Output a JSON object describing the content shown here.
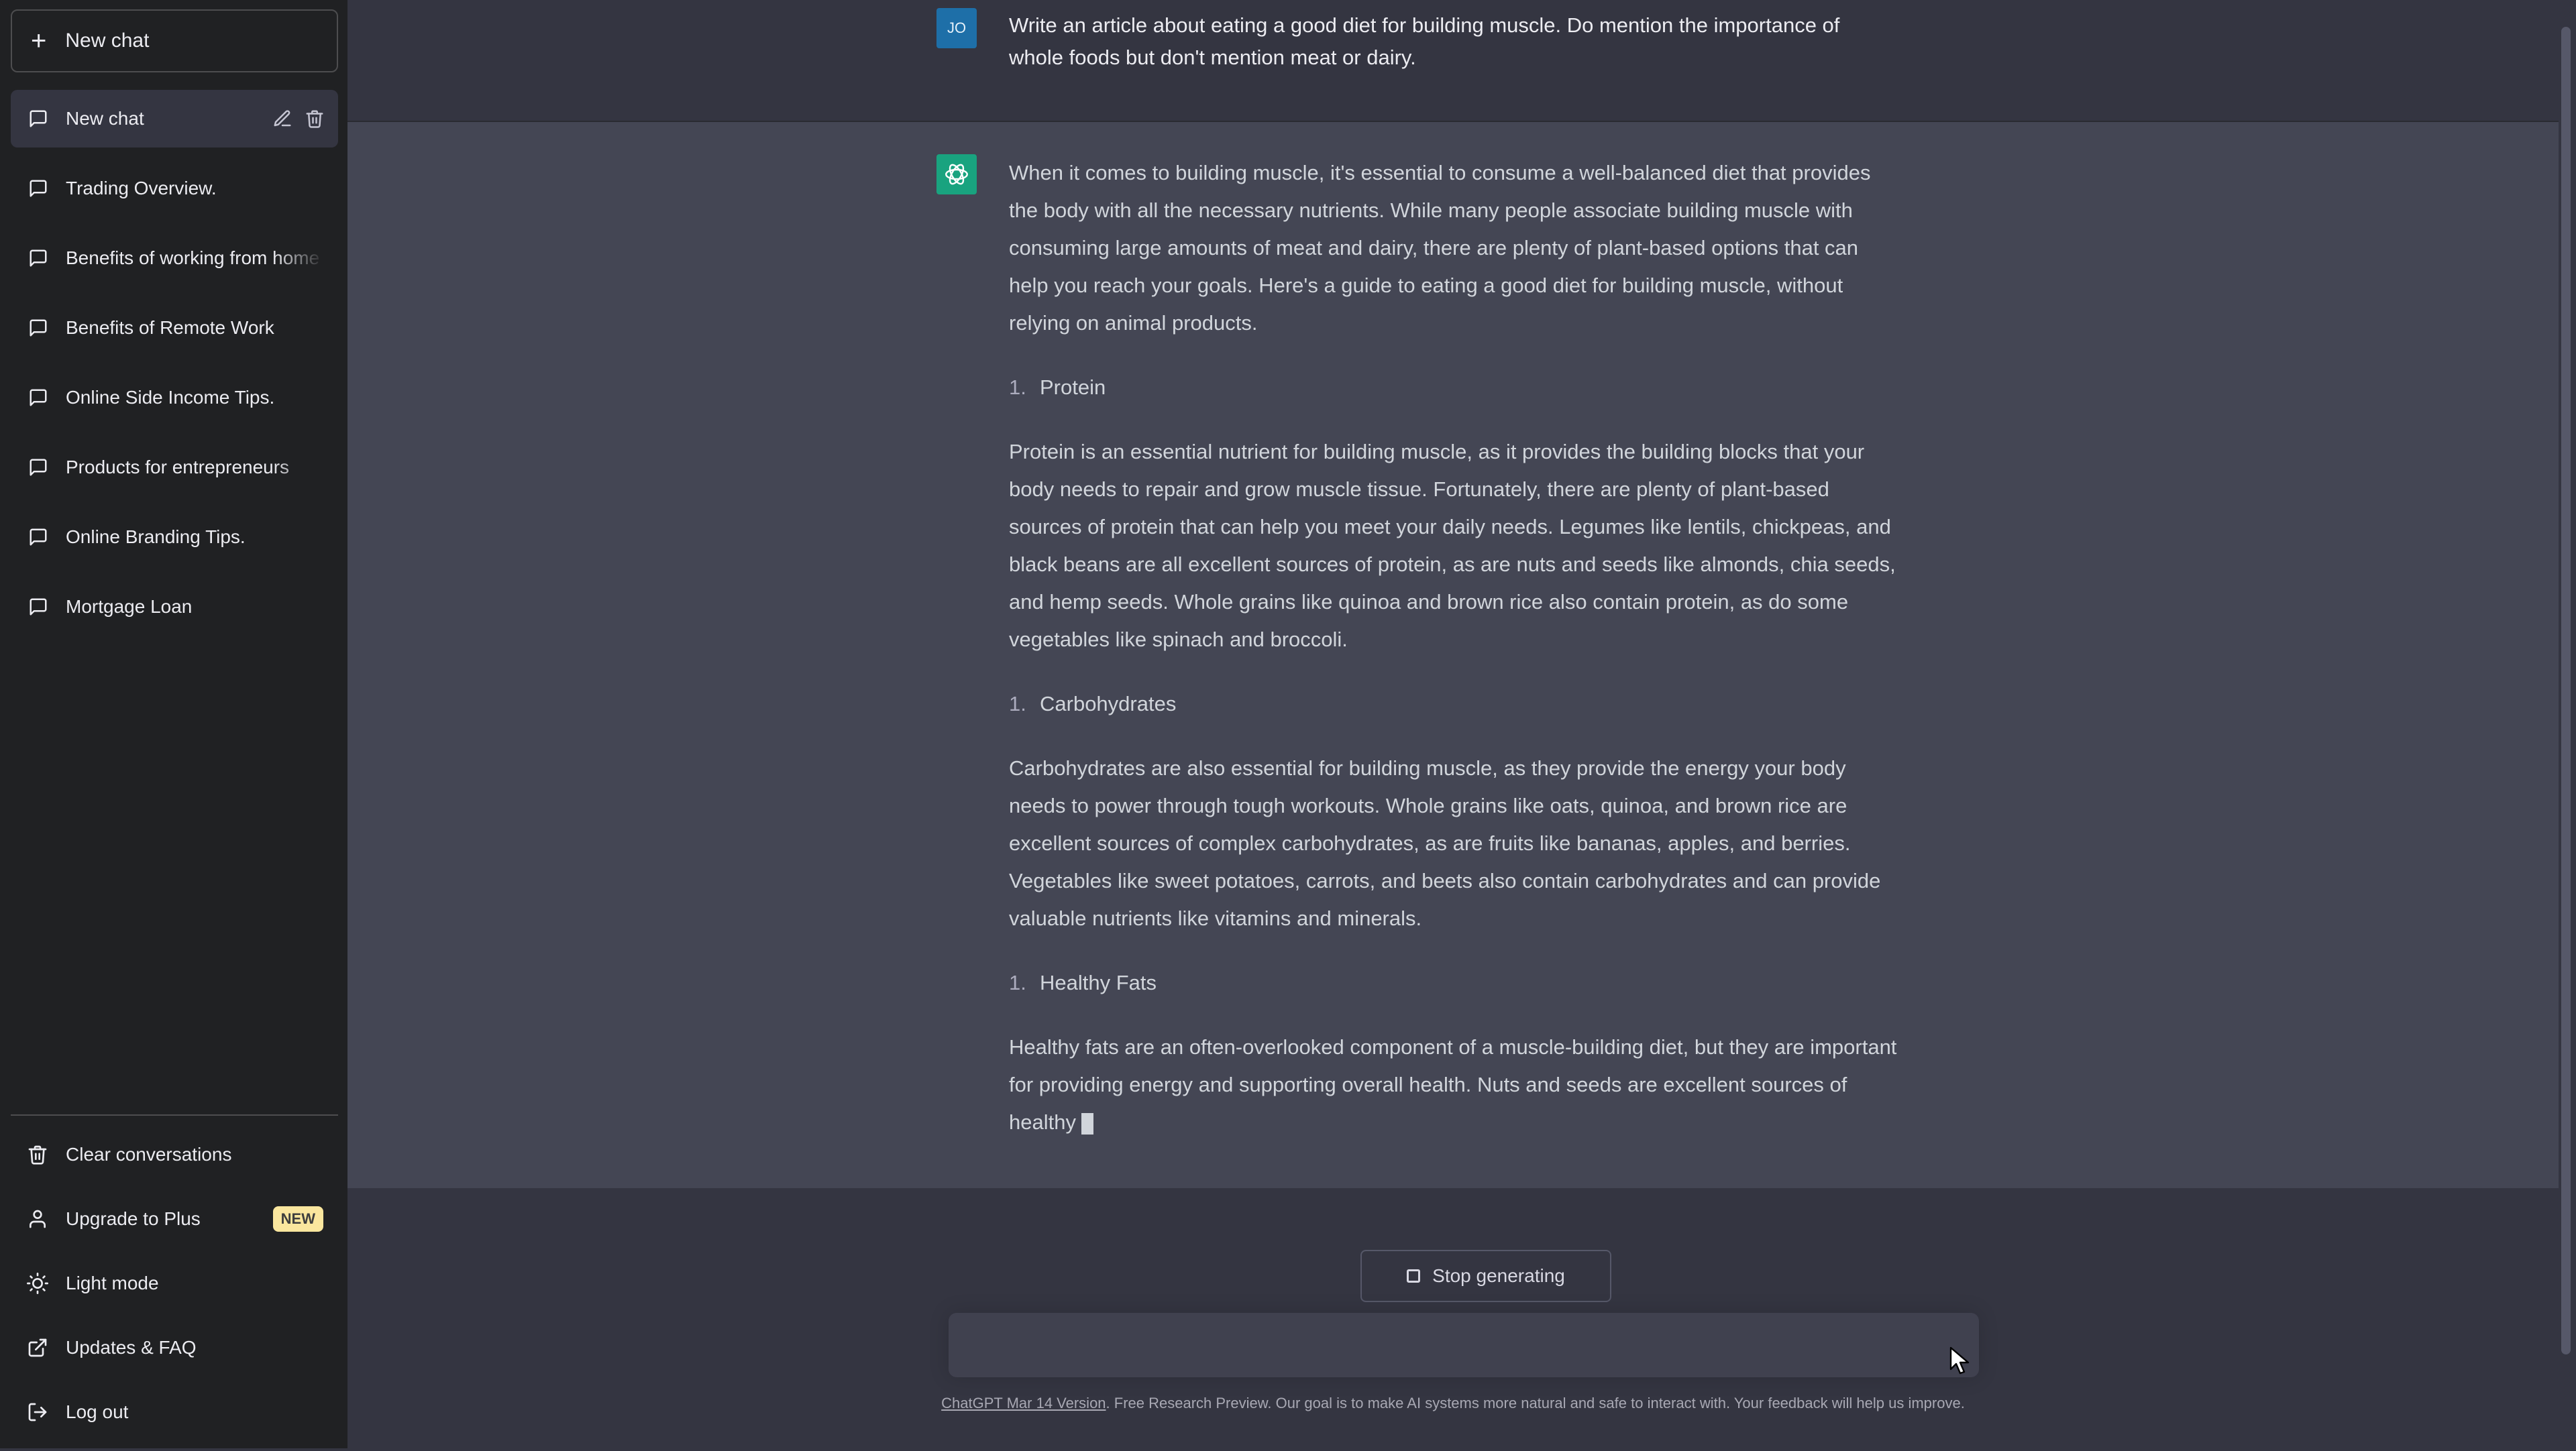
{
  "sidebar": {
    "new_chat_label": "New chat",
    "conversations": [
      {
        "label": "New chat",
        "active": true
      },
      {
        "label": "Trading Overview."
      },
      {
        "label": "Benefits of working from home"
      },
      {
        "label": "Benefits of Remote Work"
      },
      {
        "label": "Online Side Income Tips."
      },
      {
        "label": "Products for entrepreneurs"
      },
      {
        "label": "Online Branding Tips."
      },
      {
        "label": "Mortgage Loan"
      }
    ],
    "bottom": {
      "clear": "Clear conversations",
      "upgrade": "Upgrade to Plus",
      "upgrade_badge": "NEW",
      "light_mode": "Light mode",
      "updates": "Updates & FAQ",
      "logout": "Log out"
    }
  },
  "user": {
    "avatar_initials": "JO",
    "message": "Write an article about eating a good diet for building muscle. Do mention the importance of whole foods but don't mention meat or dairy."
  },
  "assistant": {
    "intro": "When it comes to building muscle, it's essential to consume a well-balanced diet that provides the body with all the necessary nutrients. While many people associate building muscle with consuming large amounts of meat and dairy, there are plenty of plant-based options that can help you reach your goals. Here's a guide to eating a good diet for building muscle, without relying on animal products.",
    "sections": [
      {
        "num": "1.",
        "heading": "Protein",
        "body": "Protein is an essential nutrient for building muscle, as it provides the building blocks that your body needs to repair and grow muscle tissue. Fortunately, there are plenty of plant-based sources of protein that can help you meet your daily needs. Legumes like lentils, chickpeas, and black beans are all excellent sources of protein, as are nuts and seeds like almonds, chia seeds, and hemp seeds. Whole grains like quinoa and brown rice also contain protein, as do some vegetables like spinach and broccoli."
      },
      {
        "num": "1.",
        "heading": "Carbohydrates",
        "body": "Carbohydrates are also essential for building muscle, as they provide the energy your body needs to power through tough workouts. Whole grains like oats, quinoa, and brown rice are excellent sources of complex carbohydrates, as are fruits like bananas, apples, and berries. Vegetables like sweet potatoes, carrots, and beets also contain carbohydrates and can provide valuable nutrients like vitamins and minerals."
      },
      {
        "num": "1.",
        "heading": "Healthy Fats",
        "body": "Healthy fats are an often-overlooked component of a muscle-building diet, but they are important for providing energy and supporting overall health. Nuts and seeds are excellent sources of healthy"
      }
    ]
  },
  "controls": {
    "stop_label": "Stop generating",
    "input_value": "",
    "input_placeholder": ""
  },
  "footer": {
    "link_text": "ChatGPT Mar 14 Version",
    "text": ". Free Research Preview. Our goal is to make AI systems more natural and safe to interact with. Your feedback will help us improve."
  },
  "icons": {
    "new_chat": "plus-icon",
    "conversation": "chat-bubble-icon",
    "edit": "pencil-icon",
    "delete": "trash-icon",
    "clear": "trash-icon",
    "upgrade": "user-icon",
    "light_mode": "sun-icon",
    "updates": "external-link-icon",
    "logout": "logout-icon",
    "stop": "stop-square-icon"
  },
  "colors": {
    "sidebar_bg": "#202123",
    "main_bg": "#343541",
    "assistant_bg": "#444654",
    "gpt_avatar": "#19a37f",
    "user_avatar": "#1e6fa8",
    "badge": "#fae69e"
  }
}
